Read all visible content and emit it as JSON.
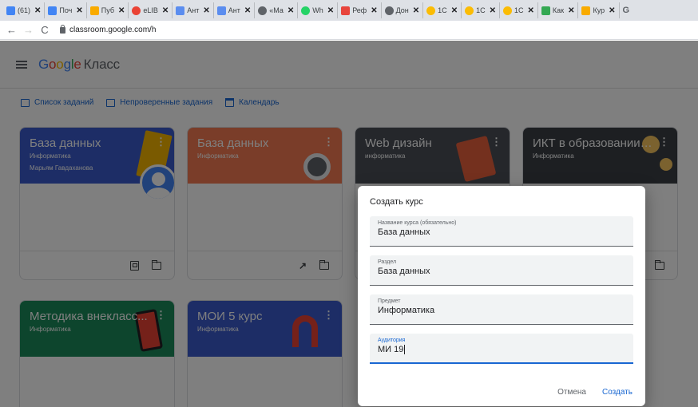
{
  "browser": {
    "tabs": [
      {
        "label": "(61)",
        "fav": "#4285f4",
        "round": false
      },
      {
        "label": "Поч",
        "fav": "#4285f4",
        "round": false
      },
      {
        "label": "Пуб",
        "fav": "#f9ab00",
        "round": false
      },
      {
        "label": "eLIB",
        "fav": "#ea4335",
        "round": true
      },
      {
        "label": "Ант",
        "fav": "#5b8def",
        "round": false
      },
      {
        "label": "Ант",
        "fav": "#5b8def",
        "round": false
      },
      {
        "label": "«Ма",
        "fav": "#5f6368",
        "round": true
      },
      {
        "label": "Wh",
        "fav": "#25d366",
        "round": true
      },
      {
        "label": "Реф",
        "fav": "#e8453c",
        "round": false
      },
      {
        "label": "Дон",
        "fav": "#5f6368",
        "round": true
      },
      {
        "label": "1С",
        "fav": "#fbbc04",
        "round": true
      },
      {
        "label": "1С",
        "fav": "#fbbc04",
        "round": true
      },
      {
        "label": "1С",
        "fav": "#fbbc04",
        "round": true
      },
      {
        "label": "Как",
        "fav": "#34a853",
        "round": false
      },
      {
        "label": "Кур",
        "fav": "#f9ab00",
        "round": false
      },
      {
        "label": "G",
        "fav": "#ffffff",
        "round": false
      }
    ],
    "close_glyph": "✕",
    "url": "classroom.google.com/h"
  },
  "app": {
    "logo": [
      "G",
      "o",
      "o",
      "g",
      "l",
      "e"
    ],
    "product": "Класс"
  },
  "subnav": {
    "todo": "Список заданий",
    "unchecked": "Непроверенные задания",
    "calendar": "Календарь"
  },
  "cards": [
    {
      "title": "База данных",
      "section": "Информатика",
      "teacher": "Марьям Гавдаханова",
      "color": "#3b5bcc"
    },
    {
      "title": "База данных",
      "section": "Информатика",
      "teacher": "",
      "color": "#f47b52"
    },
    {
      "title": "Web дизайн",
      "section": "информатика",
      "teacher": "",
      "color": "#4a4f57"
    },
    {
      "title": "ИКТ в образовании ...",
      "section": "Информатика",
      "teacher": "",
      "color": "#3a3f45"
    },
    {
      "title": "Методика внекласс...",
      "section": "Информатика",
      "teacher": "",
      "color": "#1b8a5a"
    },
    {
      "title": "МОИ 5 курс",
      "section": "Информатика",
      "teacher": "",
      "color": "#3b5bcc"
    }
  ],
  "dialog": {
    "title": "Создать курс",
    "fields": [
      {
        "label": "Название курса (обязательно)",
        "value": "База данных"
      },
      {
        "label": "Раздел",
        "value": "База данных"
      },
      {
        "label": "Предмет",
        "value": "Информатика"
      },
      {
        "label": "Аудитория",
        "value": "МИ 19"
      }
    ],
    "cancel": "Отмена",
    "create": "Создать"
  }
}
